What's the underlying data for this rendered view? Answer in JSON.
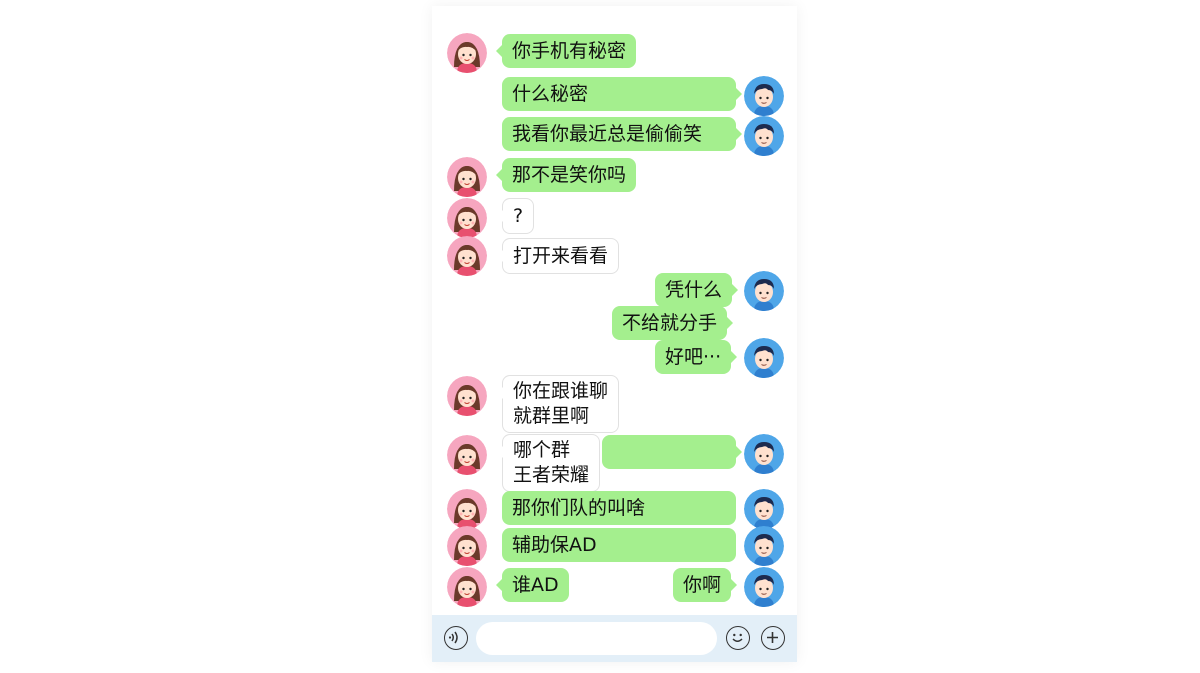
{
  "chat": {
    "messages": [
      {
        "sender": "girl",
        "text": "你手机有秘密"
      },
      {
        "sender": "boy",
        "text": "什么秘密"
      },
      {
        "sender": "boy",
        "text": "我看你最近总是偷偷笑"
      },
      {
        "sender": "girl",
        "text": "那不是笑你吗"
      },
      {
        "sender": "girl",
        "text": "?"
      },
      {
        "sender": "girl",
        "text": "打开来看看"
      },
      {
        "sender": "boy",
        "text": "凭什么"
      },
      {
        "sender": "boy",
        "text": "不给就分手"
      },
      {
        "sender": "boy",
        "text": "好吧···"
      },
      {
        "sender": "girl",
        "line1": "你在跟谁聊",
        "line2": "就群里啊"
      },
      {
        "sender": "girl",
        "line1": "哪个群",
        "line2": "王者荣耀"
      },
      {
        "sender": "girl",
        "text": "那你们队的叫啥"
      },
      {
        "sender": "girl",
        "text": "辅助保AD"
      },
      {
        "sender": "girl",
        "text": "谁AD"
      },
      {
        "sender": "boy",
        "text": "你啊"
      }
    ]
  },
  "input_bar": {
    "voice_icon": "voice-icon",
    "emoji_icon": "emoji-icon",
    "plus_icon": "plus-icon",
    "placeholder": ""
  },
  "colors": {
    "bubble_green": "#a4ef8e",
    "bubble_white": "#ffffff",
    "input_bar_bg": "#e3eff8",
    "girl_avatar_bg": "#f6a6bf",
    "boy_avatar_bg": "#4fa6e8"
  }
}
